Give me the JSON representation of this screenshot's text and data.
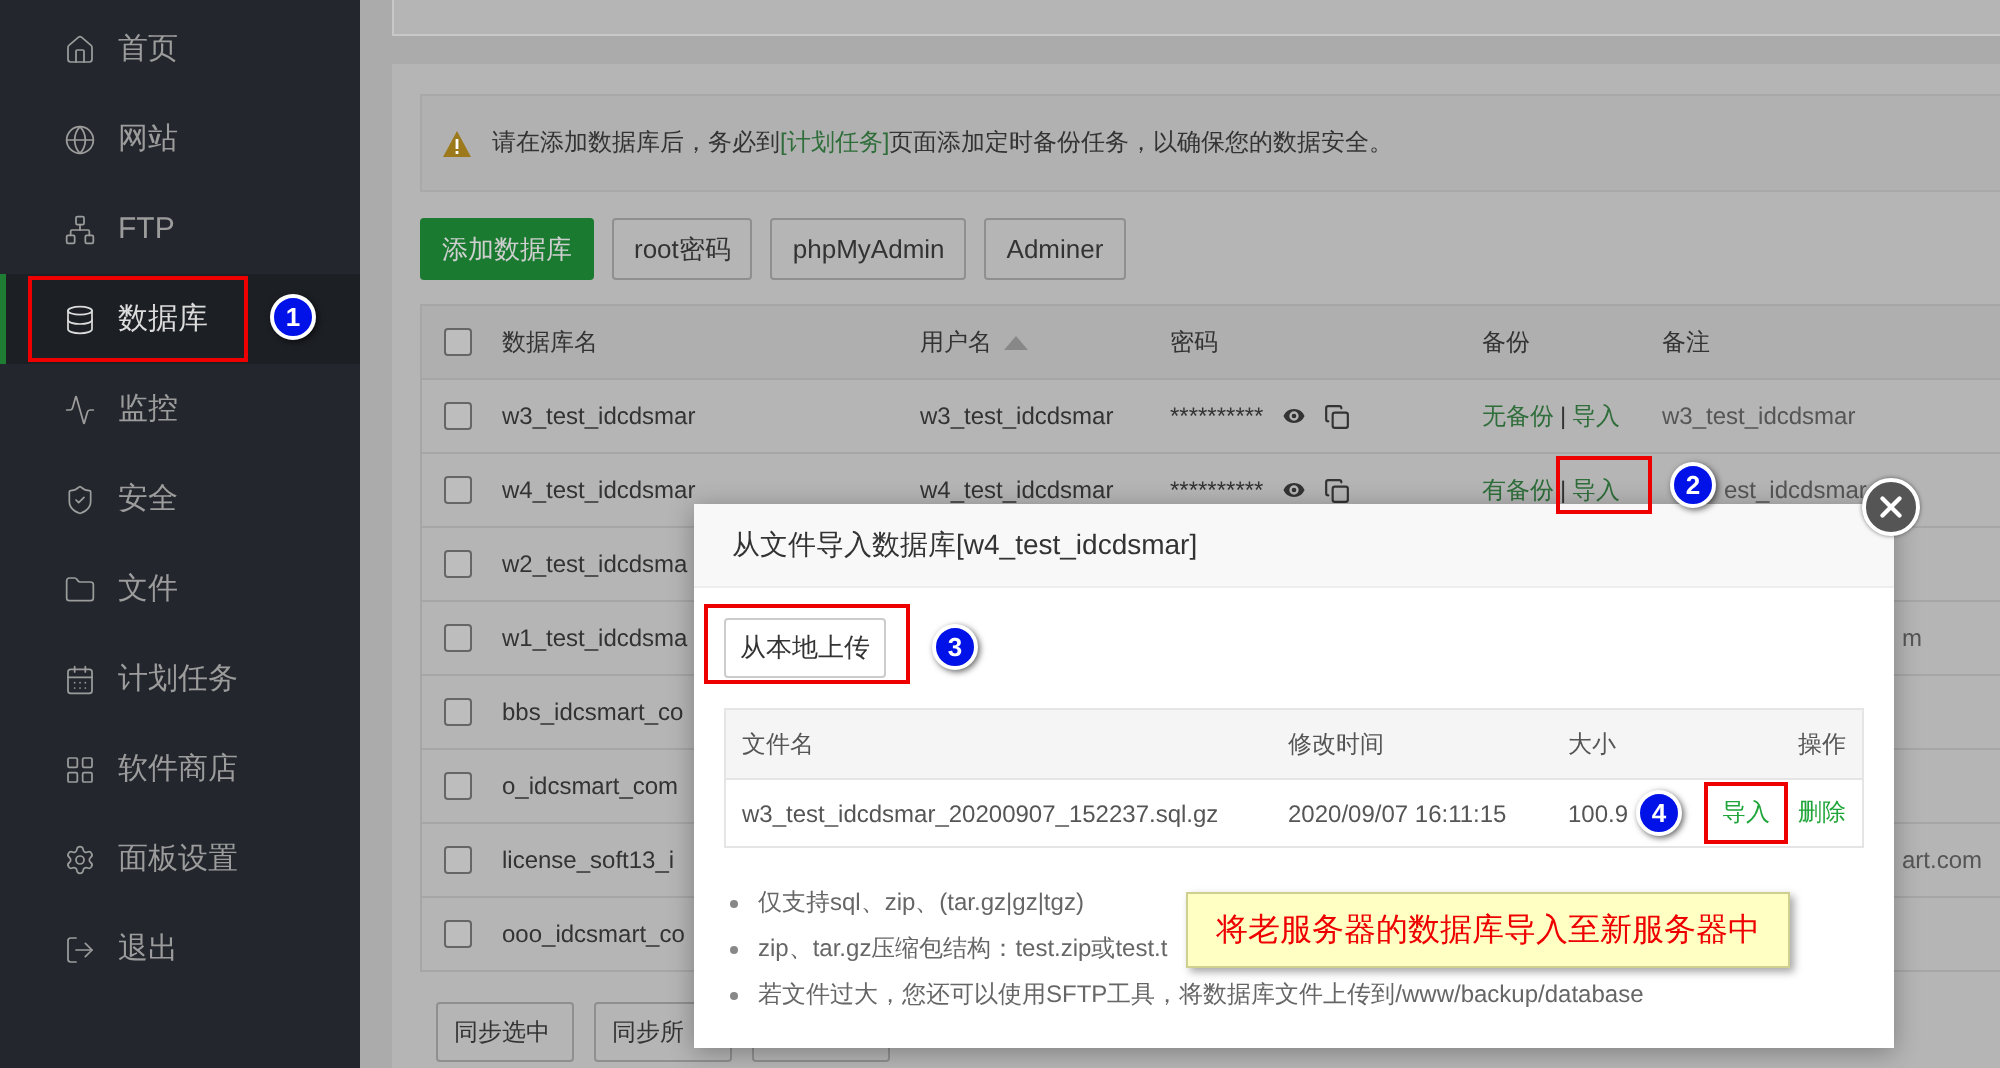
{
  "sidebar": {
    "items": [
      {
        "label": "首页",
        "selected": false
      },
      {
        "label": "网站",
        "selected": false
      },
      {
        "label": "FTP",
        "selected": false
      },
      {
        "label": "数据库",
        "selected": true
      },
      {
        "label": "监控",
        "selected": false
      },
      {
        "label": "安全",
        "selected": false
      },
      {
        "label": "文件",
        "selected": false
      },
      {
        "label": "计划任务",
        "selected": false
      },
      {
        "label": "软件商店",
        "selected": false
      },
      {
        "label": "面板设置",
        "selected": false
      },
      {
        "label": "退出",
        "selected": false
      }
    ]
  },
  "notice": {
    "before": "请在添加数据库后，务必到",
    "link": "[计划任务]",
    "after": "页面添加定时备份任务，以确保您的数据安全。"
  },
  "toolbar": [
    {
      "label": "添加数据库",
      "kind": "primary"
    },
    {
      "label": "root密码",
      "kind": "default"
    },
    {
      "label": "phpMyAdmin",
      "kind": "default"
    },
    {
      "label": "Adminer",
      "kind": "default"
    }
  ],
  "table": {
    "columns": [
      {
        "label": "数据库名",
        "sorted": false
      },
      {
        "label": "用户名",
        "sorted": true
      },
      {
        "label": "密码",
        "sorted": false
      },
      {
        "label": "备份",
        "sorted": false
      },
      {
        "label": "备注",
        "sorted": false
      }
    ],
    "header_checked": false,
    "rows": [
      {
        "kind": "full",
        "checked": false,
        "name": "w3_test_idcdsmar",
        "user": "w3_test_idcdsmar",
        "password": "**********",
        "backup": "无备份",
        "separator": "|",
        "import": "导入",
        "remark": "w3_test_idcdsmar"
      },
      {
        "kind": "clipped",
        "checked": false,
        "name": "w4_test_idcdsmar",
        "user": "w4_test_idcdsmar",
        "password": "**********",
        "backup": "有备份",
        "separator": "|",
        "import": "导入",
        "remark": "est_idcdsmar"
      },
      {
        "kind": "covered",
        "checked": false,
        "name": "w2_test_idcdsma"
      },
      {
        "kind": "covered",
        "checked": false,
        "name": "w1_test_idcdsma",
        "remark": "m"
      },
      {
        "kind": "covered",
        "checked": false,
        "name": "bbs_idcsmart_co"
      },
      {
        "kind": "covered",
        "checked": false,
        "name": "o_idcsmart_com"
      },
      {
        "kind": "covered",
        "checked": false,
        "name": "license_soft13_i",
        "remark": "art.com"
      },
      {
        "kind": "covered",
        "checked": false,
        "name": "ooo_idcsmart_co"
      }
    ]
  },
  "footer_buttons": [
    "同步选中",
    "同步所"
  ],
  "dialog": {
    "title": "从文件导入数据库[w4_test_idcdsmar]",
    "upload_button": "从本地上传",
    "columns": [
      "文件名",
      "修改时间",
      "大小",
      "操作"
    ],
    "rows": [
      {
        "file": "w3_test_idcdsmar_20200907_152237.sql.gz",
        "modified": "2020/09/07 16:11:15",
        "size": "100.9",
        "actions": [
          "导入",
          "删除"
        ]
      }
    ],
    "notes": [
      "仅支持sql、zip、(tar.gz|gz|tgz)",
      "zip、tar.gz压缩包结构：test.zip或test.t",
      "若文件过大，您还可以使用SFTP工具，将数据库文件上传到/www/backup/database"
    ]
  },
  "annotations": {
    "markers": [
      "1",
      "2",
      "3",
      "4"
    ],
    "callout": "将老服务器的数据库导入至新服务器中"
  }
}
